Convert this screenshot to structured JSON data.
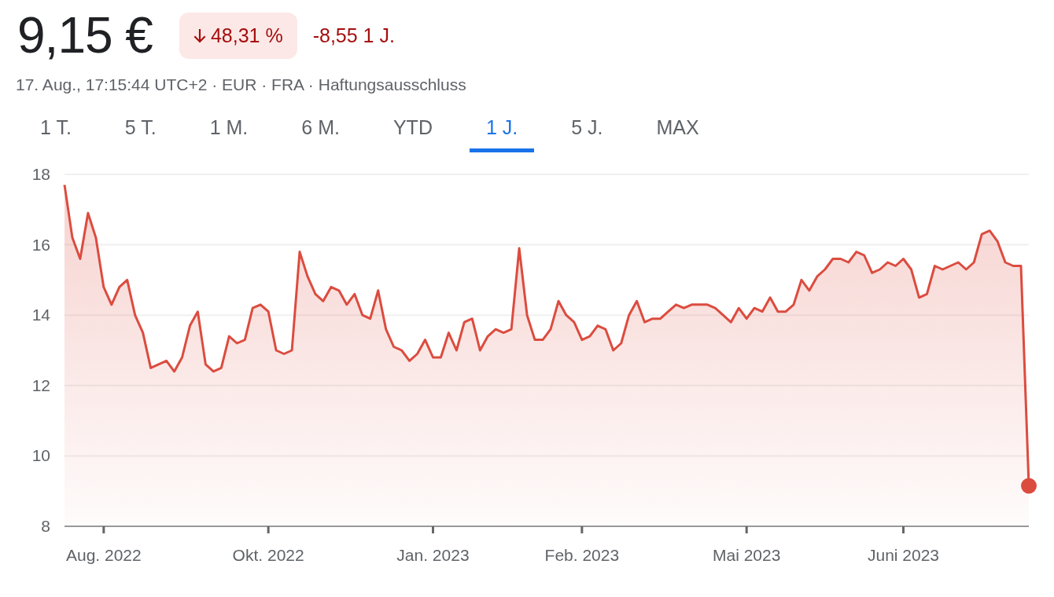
{
  "quote": {
    "price": "9,15 €",
    "change_badge": {
      "percent": "48,31 %"
    },
    "change": "-8,55 1 J."
  },
  "meta": {
    "info": "17. Aug., 17:15:44 UTC+2 · EUR · FRA ·",
    "disclaimer_link": "Haftungsausschluss"
  },
  "ranges": [
    {
      "label": "1 T.",
      "selected": false
    },
    {
      "label": "5 T.",
      "selected": false
    },
    {
      "label": "1 M.",
      "selected": false
    },
    {
      "label": "6 M.",
      "selected": false
    },
    {
      "label": "YTD",
      "selected": false
    },
    {
      "label": "1 J.",
      "selected": true
    },
    {
      "label": "5 J.",
      "selected": false
    },
    {
      "label": "MAX",
      "selected": false
    }
  ],
  "chart": {
    "chart_data": {
      "type": "area",
      "grid": true,
      "ylim": [
        8,
        18
      ],
      "categories": [
        null,
        null,
        null,
        null,
        null,
        "Aug. 2022",
        null,
        null,
        null,
        null,
        null,
        null,
        null,
        null,
        null,
        null,
        null,
        null,
        null,
        null,
        null,
        null,
        null,
        null,
        null,
        null,
        "Okt. 2022",
        null,
        null,
        null,
        null,
        null,
        null,
        null,
        null,
        null,
        null,
        null,
        null,
        null,
        null,
        null,
        null,
        null,
        null,
        null,
        null,
        "Jan. 2023",
        null,
        null,
        null,
        null,
        null,
        null,
        null,
        null,
        null,
        null,
        null,
        null,
        null,
        null,
        null,
        null,
        null,
        null,
        "Feb. 2023",
        null,
        null,
        null,
        null,
        null,
        null,
        null,
        null,
        null,
        null,
        null,
        null,
        null,
        null,
        null,
        null,
        null,
        null,
        null,
        null,
        "Mai 2023",
        null,
        null,
        null,
        null,
        null,
        null,
        null,
        null,
        null,
        null,
        null,
        null,
        null,
        null,
        null,
        null,
        null,
        null,
        null,
        "Juni 2023",
        null,
        null,
        null,
        null,
        null,
        null,
        null,
        null,
        null,
        null,
        null,
        null,
        null,
        null,
        null,
        null
      ],
      "yticks": [
        8,
        10,
        12,
        14,
        16,
        18
      ],
      "series": [
        {
          "color": "#db4c3f",
          "values": [
            17.7,
            16.2,
            15.6,
            16.9,
            16.2,
            14.8,
            14.3,
            14.8,
            15.0,
            14.0,
            13.5,
            12.5,
            12.6,
            12.7,
            12.4,
            12.8,
            13.7,
            14.1,
            12.6,
            12.4,
            12.5,
            13.4,
            13.2,
            13.3,
            14.2,
            14.3,
            14.1,
            13.0,
            12.9,
            13.0,
            15.8,
            15.1,
            14.6,
            14.4,
            14.8,
            14.7,
            14.3,
            14.6,
            14.0,
            13.9,
            14.7,
            13.6,
            13.1,
            13.0,
            12.7,
            12.9,
            13.3,
            12.8,
            12.8,
            13.5,
            13.0,
            13.8,
            13.9,
            13.0,
            13.4,
            13.6,
            13.5,
            13.6,
            15.9,
            14.0,
            13.3,
            13.3,
            13.6,
            14.4,
            14.0,
            13.8,
            13.3,
            13.4,
            13.7,
            13.6,
            13.0,
            13.2,
            14.0,
            14.4,
            13.8,
            13.9,
            13.9,
            14.1,
            14.3,
            14.2,
            14.3,
            14.3,
            14.3,
            14.2,
            14.0,
            13.8,
            14.2,
            13.9,
            14.2,
            14.1,
            14.5,
            14.1,
            14.1,
            14.3,
            15.0,
            14.7,
            15.1,
            15.3,
            15.6,
            15.6,
            15.5,
            15.8,
            15.7,
            15.2,
            15.3,
            15.5,
            15.4,
            15.6,
            15.3,
            14.5,
            14.6,
            15.4,
            15.3,
            15.4,
            15.5,
            15.3,
            15.5,
            16.3,
            16.4,
            16.1,
            15.5,
            15.4,
            15.4,
            9.15
          ]
        }
      ]
    }
  }
}
